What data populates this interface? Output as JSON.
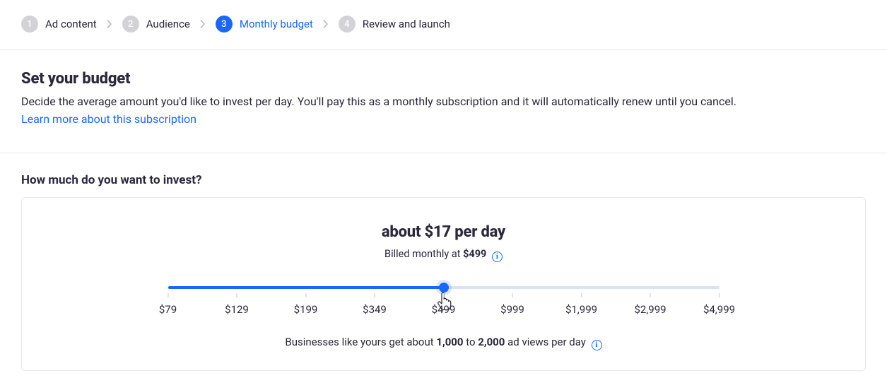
{
  "stepper": {
    "steps": [
      {
        "num": "1",
        "label": "Ad content",
        "active": false
      },
      {
        "num": "2",
        "label": "Audience",
        "active": false
      },
      {
        "num": "3",
        "label": "Monthly budget",
        "active": true
      },
      {
        "num": "4",
        "label": "Review and launch",
        "active": false
      }
    ]
  },
  "heading": {
    "title": "Set your budget",
    "subtitle": "Decide the average amount you'd like to invest per day. You'll pay this as a monthly subscription and it will automatically renew until you cancel.",
    "learn_more": "Learn more about this subscription"
  },
  "section_question": "How much do you want to invest?",
  "card": {
    "per_day_label": "about $17 per day",
    "billed_prefix": "Billed monthly at ",
    "billed_amount": "$499",
    "footer_prefix": "Businesses like yours get about ",
    "footer_low": "1,000",
    "footer_mid": " to ",
    "footer_high": "2,000",
    "footer_suffix": " ad views per day "
  },
  "slider": {
    "stops": [
      "$79",
      "$129",
      "$199",
      "$349",
      "$499",
      "$999",
      "$1,999",
      "$2,999",
      "$4,999"
    ],
    "selected_index": 4
  },
  "colors": {
    "accent": "#1a66ff"
  }
}
